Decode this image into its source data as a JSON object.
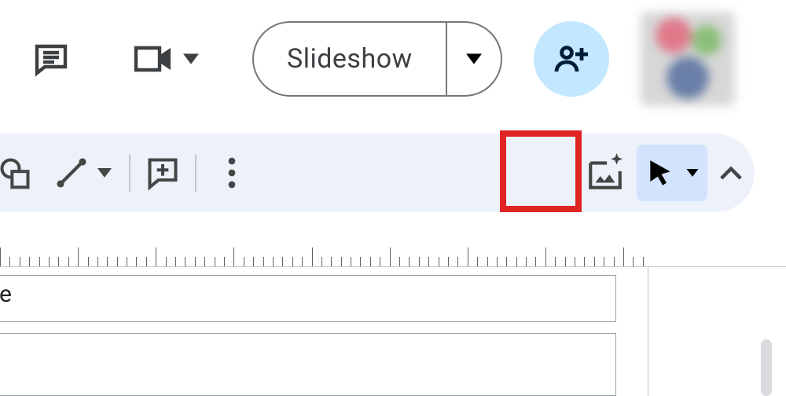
{
  "header": {
    "slideshow_label": "Slideshow"
  },
  "icons": {
    "comments": "comments-icon",
    "meet": "meet-video-icon",
    "caret_down": "caret-down-icon",
    "share": "share-person-add-icon",
    "shape": "shape-icon",
    "line": "line-icon",
    "add_comment": "add-comment-icon",
    "more": "more-vertical-icon",
    "gen_image": "generate-image-ai-icon",
    "pointer": "pointer-cursor-icon",
    "collapse": "chevron-up-icon"
  },
  "canvas": {
    "fragment_text": "e"
  }
}
